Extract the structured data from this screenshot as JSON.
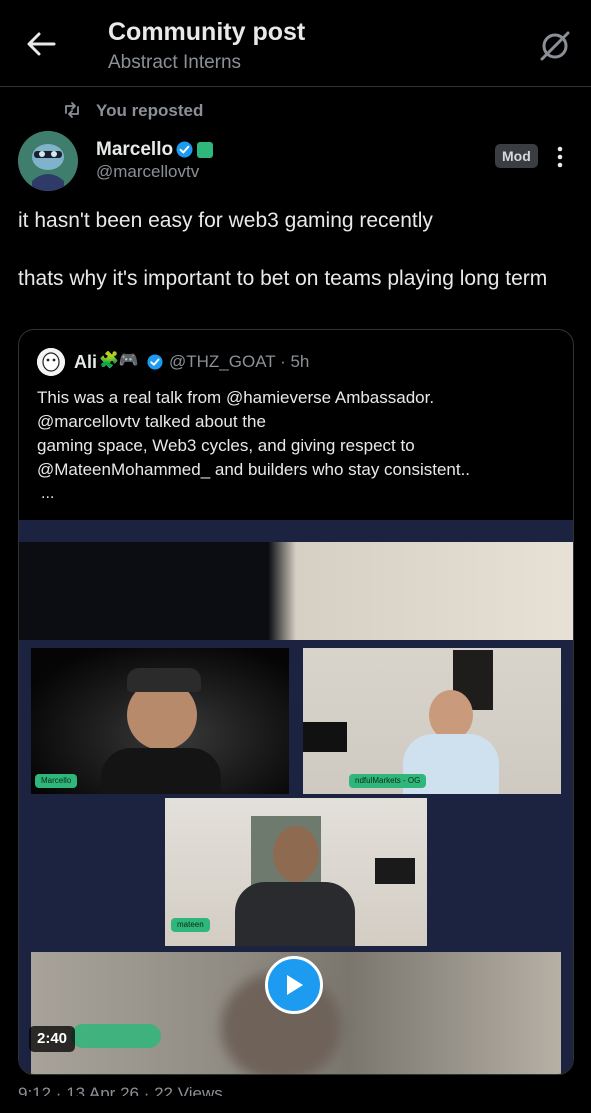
{
  "header": {
    "title": "Community post",
    "subtitle": "Abstract Interns",
    "back_icon": "arrow-left-icon",
    "action_icon": "share-icon"
  },
  "repost": {
    "label": "You reposted",
    "icon": "repost-icon"
  },
  "post": {
    "author_name": "Marcello",
    "author_handle": "@marcellovtv",
    "badge": "Mod",
    "text": "it hasn't been easy for web3 gaming recently\n\nthats why it's important to bet on teams playing long term"
  },
  "quote": {
    "author_name": "Ali",
    "author_emoji": "🧩🎮",
    "handle_time": "@THZ_GOAT · 5h",
    "text": "This was a real talk from @hamieverse Ambassador.\n@marcellovtv talked about the\ngaming space, Web3 cycles, and giving respect to\n@MateenMohammed_ and builders who stay consistent..",
    "more": "...",
    "video": {
      "duration": "2:40",
      "tags": [
        "Marcello",
        "ndfulMarkets - OG",
        "mateen"
      ]
    }
  },
  "footer_partial": "9:12 · 13 Apr 26 · 22 Views",
  "colors": {
    "background": "#000000",
    "text": "#e7e9ea",
    "muted": "#8b9096",
    "accent": "#1d9bf0",
    "border": "#2f3336"
  }
}
